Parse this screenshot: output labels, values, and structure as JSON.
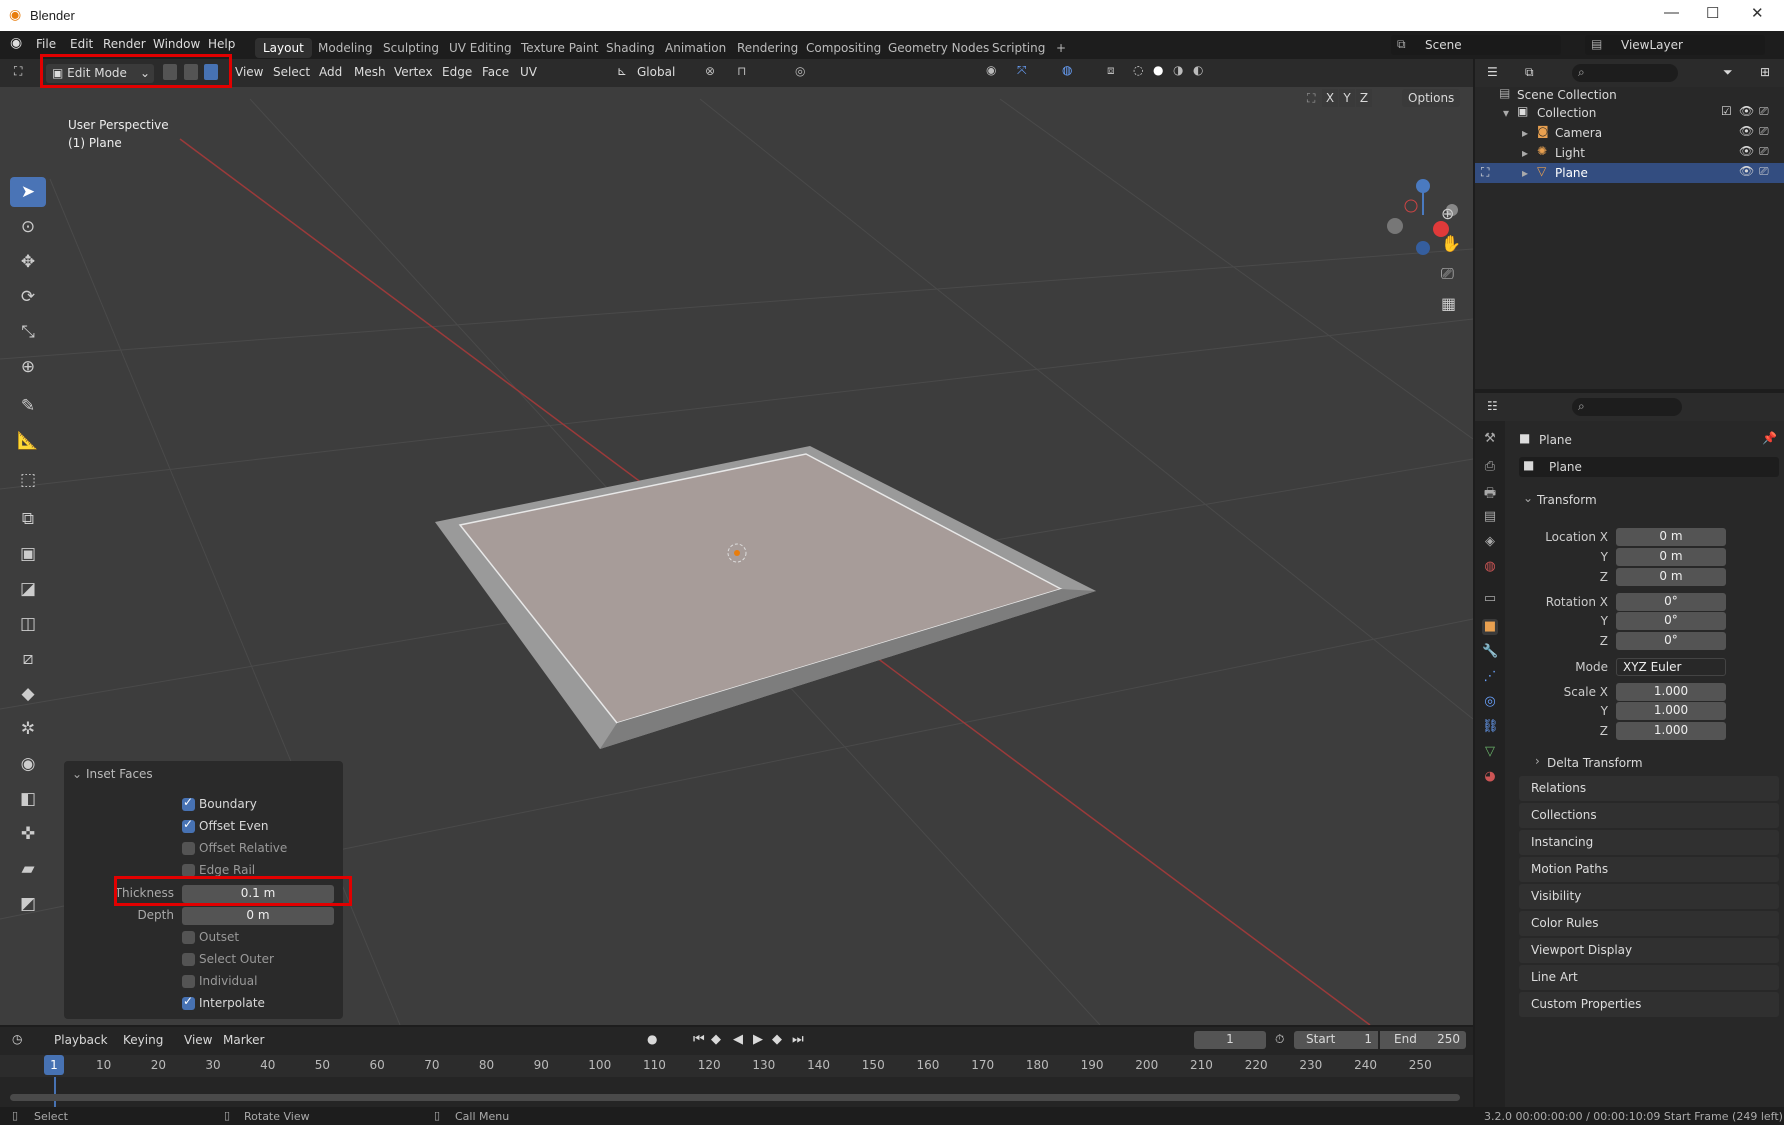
{
  "window": {
    "title": "Blender",
    "minimize": "—",
    "maximize": "☐",
    "close": "✕"
  },
  "menus": [
    "File",
    "Edit",
    "Render",
    "Window",
    "Help"
  ],
  "workspaces": [
    "Layout",
    "Modeling",
    "Sculpting",
    "UV Editing",
    "Texture Paint",
    "Shading",
    "Animation",
    "Rendering",
    "Compositing",
    "Geometry Nodes",
    "Scripting",
    "+"
  ],
  "active_workspace": "Layout",
  "scene": "Scene",
  "view_layer": "ViewLayer",
  "viewport": {
    "mode": "Edit Mode",
    "menus": [
      "View",
      "Select",
      "Add",
      "Mesh",
      "Vertex",
      "Edge",
      "Face",
      "UV"
    ],
    "transform_orientation": "Global",
    "options": "Options",
    "axes": [
      "X",
      "Y",
      "Z"
    ],
    "perspective": "User Perspective",
    "object": "(1) Plane"
  },
  "operator_panel": {
    "title": "Inset Faces",
    "boundary": "Boundary",
    "offset_even": "Offset Even",
    "offset_relative": "Offset Relative",
    "edge_rail": "Edge Rail",
    "thickness_label": "Thickness",
    "thickness_value": "0.1 m",
    "depth_label": "Depth",
    "depth_value": "0 m",
    "outset": "Outset",
    "select_outer": "Select Outer",
    "individual": "Individual",
    "interpolate": "Interpolate"
  },
  "outliner": {
    "root": "Scene Collection",
    "collection": "Collection",
    "items": [
      "Camera",
      "Light",
      "Plane"
    ],
    "selected": "Plane"
  },
  "properties": {
    "object_name": "Plane",
    "datablock": "Plane",
    "transform_header": "Transform",
    "location_label": "Location X",
    "rotation_label": "Rotation X",
    "scale_label": "Scale X",
    "y": "Y",
    "z": "Z",
    "location": [
      "0 m",
      "0 m",
      "0 m"
    ],
    "rotation": [
      "0°",
      "0°",
      "0°"
    ],
    "mode_label": "Mode",
    "mode_value": "XYZ Euler",
    "scale": [
      "1.000",
      "1.000",
      "1.000"
    ],
    "delta": "Delta Transform",
    "panels": [
      "Relations",
      "Collections",
      "Instancing",
      "Motion Paths",
      "Visibility",
      "Color Rules",
      "Viewport Display",
      "Line Art",
      "Custom Properties"
    ]
  },
  "timeline": {
    "menus": [
      "Playback",
      "Keying",
      "View",
      "Marker"
    ],
    "current_frame": "1",
    "start_label": "Start",
    "start": "1",
    "end_label": "End",
    "end": "250",
    "ticks": [
      "10",
      "20",
      "30",
      "40",
      "50",
      "60",
      "70",
      "80",
      "90",
      "100",
      "110",
      "120",
      "130",
      "140",
      "150",
      "160",
      "170",
      "180",
      "190",
      "200",
      "210",
      "220",
      "230",
      "240",
      "250"
    ],
    "cursor": "1"
  },
  "statusbar": {
    "select": "Select",
    "rotate": "Rotate View",
    "call_menu": "Call Menu",
    "right": "3.2.0  00:00:00:00 / 00:00:10:09  Start Frame (249 left)"
  }
}
